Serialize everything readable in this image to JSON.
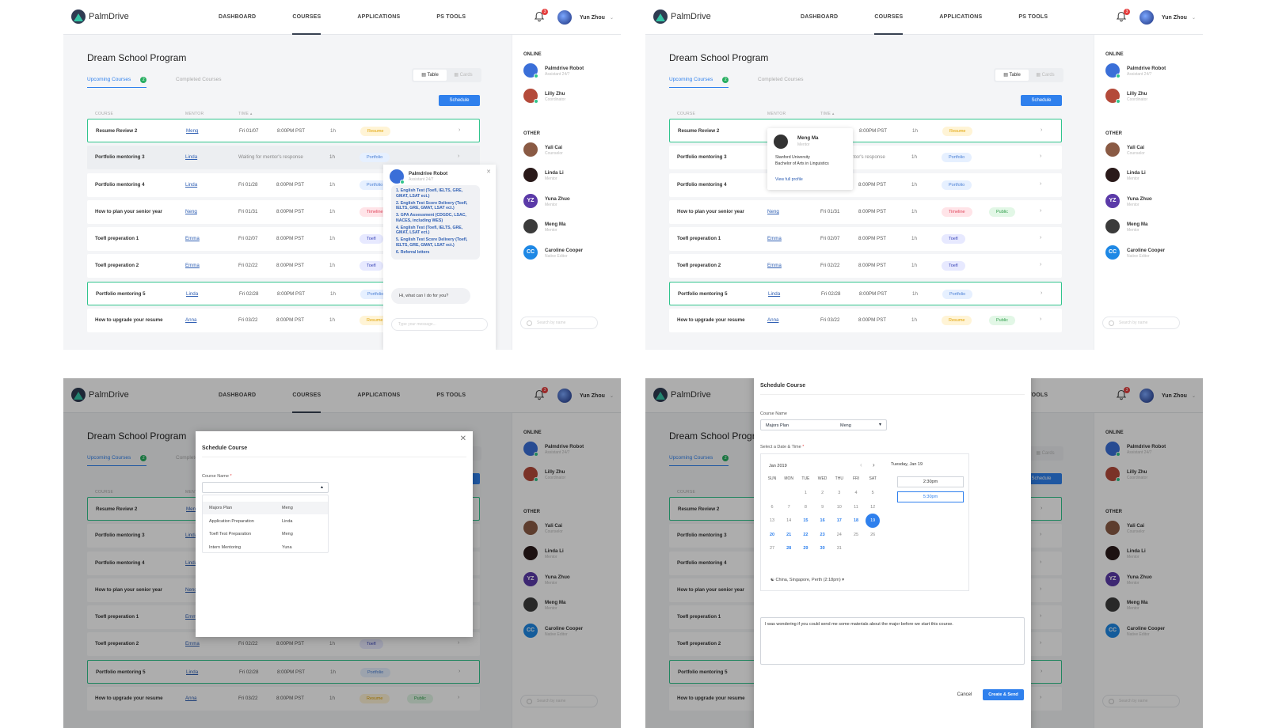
{
  "nav": {
    "logo": "PalmDrive",
    "links": [
      "DASHBOARD",
      "COURSES",
      "APPLICATIONS",
      "PS TOOLS"
    ],
    "active": "COURSES",
    "notifications": "3",
    "username": "Yun Zhou"
  },
  "main": {
    "title": "Dream School Program",
    "tab_upcoming": "Upcoming Courses",
    "tab_upcoming_count": "2",
    "tab_completed": "Completed Courses",
    "view_table": "Table",
    "view_cards": "Cards",
    "schedule_button": "Schedule",
    "columns": {
      "course": "COURSE",
      "mentor": "MENTOR",
      "time": "TIME"
    },
    "rows": [
      {
        "name": "Resume Review 2",
        "mentor": "Meng",
        "date": "Fri 01/07",
        "time": "8:00PM PST",
        "duration": "1h",
        "tags": [
          "Resume"
        ]
      },
      {
        "name": "Portfolio mentoring 3",
        "mentor": "Linda",
        "status": "Waiting for mentor's response",
        "duration": "1h",
        "tags": [
          "Portfolio"
        ]
      },
      {
        "name": "Portfolio mentoring 4",
        "mentor": "Linda",
        "date": "Fri 01/28",
        "time": "8:00PM PST",
        "duration": "1h",
        "tags": [
          "Portfolio"
        ]
      },
      {
        "name": "How to plan your senior year",
        "mentor": "Neng",
        "date": "Fri 01/31",
        "time": "8:00PM PST",
        "duration": "1h",
        "tags": [
          "Timeline",
          "Public"
        ]
      },
      {
        "name": "Toefl preperation 1",
        "mentor": "Emma",
        "date": "Fri 02/07",
        "time": "8:00PM PST",
        "duration": "1h",
        "tags": [
          "Toefl"
        ]
      },
      {
        "name": "Toefl preperation 2",
        "mentor": "Emma",
        "date": "Fri 02/22",
        "time": "8:00PM PST",
        "duration": "1h",
        "tags": [
          "Toefl"
        ]
      },
      {
        "name": "Portfolio mentoring 5",
        "mentor": "Linda",
        "date": "Fri 02/28",
        "time": "8:00PM PST",
        "duration": "1h",
        "tags": [
          "Portfolio"
        ]
      },
      {
        "name": "How to upgrade your resume",
        "mentor": "Anna",
        "date": "Fri 03/22",
        "time": "8:00PM PST",
        "duration": "1h",
        "tags": [
          "Resume",
          "Public"
        ]
      }
    ]
  },
  "sidebar": {
    "online_label": "ONLINE",
    "other_label": "OTHER",
    "online": [
      {
        "name": "Palmdrive Robot",
        "role": "Assistant 24/7"
      },
      {
        "name": "Lilly Zhu",
        "role": "Coordinator"
      }
    ],
    "other": [
      {
        "name": "Yali Cai",
        "role": "Counselor"
      },
      {
        "name": "Linda Li",
        "role": "Mentor"
      },
      {
        "name": "Yuna Zhuo",
        "role": "Mentor",
        "initials": "YZ"
      },
      {
        "name": "Meng Ma",
        "role": "Mentor"
      },
      {
        "name": "Caroline Cooper",
        "role": "Native Editor",
        "initials": "CC"
      }
    ],
    "search_placeholder": "Search by name"
  },
  "chat": {
    "name": "Palmdrive Robot",
    "role": "Assistant 24/7",
    "items": [
      "1. English Test (Toefl, IELTS, GRE, GMAT, LSAT ect.)",
      "2. English Test Score Delivery (Toefl, IELTS, GRE, GMAT, LSAT ect.)",
      "3. GPA Assessment (CDGDC, LSAC, NACES, including WES)",
      "4. English Test (Toefl, IELTS, GRE, GMAT, LSAT ect.)",
      "5. English Test Score Delivery (Toefl, IELTS, GRE, GMAT, LSAT ect.)",
      "6. Referral letters"
    ],
    "greeting": "Hi, what can I do for you?",
    "input_placeholder": "Type your message..."
  },
  "profile_popover": {
    "name": "Meng Ma",
    "role": "Mentor",
    "school": "Stanford University",
    "degree": "Bachelor of Arts in Linguistics",
    "link": "View full profile"
  },
  "schedule_dropdown": {
    "title": "Schedule Course",
    "course_label": "Course Name",
    "options": [
      {
        "course": "Majors Plan",
        "mentor": "Meng"
      },
      {
        "course": "Application Preparation",
        "mentor": "Linda"
      },
      {
        "course": "Toefl Test Preparation",
        "mentor": "Meng"
      },
      {
        "course": "Intern Mentoring",
        "mentor": "Yuna"
      }
    ]
  },
  "schedule_full": {
    "title": "Schedule Course",
    "course_label": "Course Name",
    "course_value": "Majors Plan",
    "mentor_value": "Meng",
    "datetime_label": "Select a Date & Time",
    "month": "Jan 2019",
    "weekdays": [
      "SUN",
      "MON",
      "TUE",
      "WED",
      "THU",
      "FRI",
      "SAT"
    ],
    "days": [
      "1",
      "2",
      "3",
      "4",
      "5",
      "6",
      "7",
      "8",
      "9",
      "10",
      "11",
      "12",
      "13",
      "14",
      "15",
      "16",
      "17",
      "18",
      "19",
      "20",
      "21",
      "22",
      "23",
      "24",
      "25",
      "26",
      "27",
      "28",
      "29",
      "30",
      "31"
    ],
    "selected_day": "19",
    "selected_date": "Tuesday, Jan 19",
    "slots": [
      "2:30pm",
      "5:30pm"
    ],
    "timezone": "China, Singapore, Perth (2:18pm)",
    "message": "I was wondering if you could send me some materials about the major before we start this course.",
    "cancel": "Cancel",
    "create": "Create & Send"
  },
  "colors": {
    "accent": "#2f80ed",
    "highlight_border": "#31c48d",
    "online_dot": "#31c48d"
  }
}
